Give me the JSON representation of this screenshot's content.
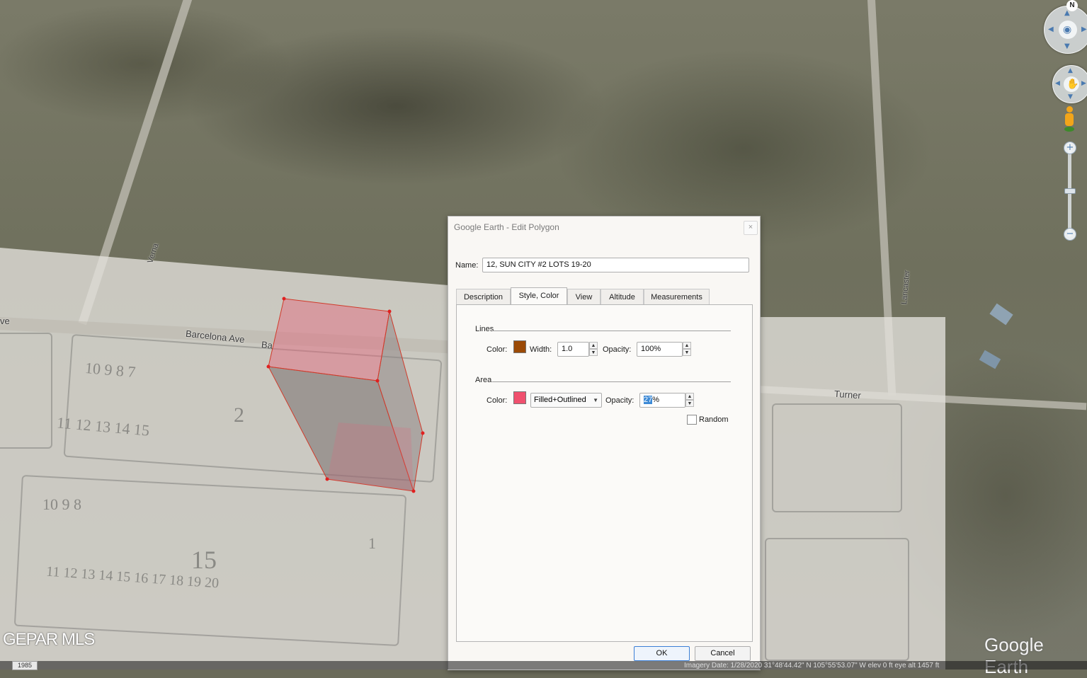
{
  "map": {
    "streets": {
      "barcelona": "Barcelona Ave",
      "barcelona_cut": "Ba",
      "verna": "Verna",
      "turner": "Turner",
      "lancaster": "Lancaster",
      "left_edge": "ve"
    },
    "plat_numbers": [
      "10 9 8 7",
      "2",
      "11 12 13 14 15",
      "15",
      "10 9 8",
      "11 12 13 14 15 16 17 18 19 20",
      "1"
    ],
    "watermark": "GEPAR MLS",
    "logo": "Google Earth",
    "year": "1985",
    "status": "Imagery Date: 1/28/2020    31°48'44.42\" N  105°55'53.07\" W  elev   0 ft    eye alt  1457 ft",
    "polygon_color": "#e5647a",
    "polygon_outline": "#d03a2a"
  },
  "nav": {
    "north": "N",
    "look_icon": "eye-icon",
    "move_icon": "hand-icon",
    "streetview_icon": "pegman-icon",
    "zoom_in": "+",
    "zoom_out": "−"
  },
  "dialog": {
    "title": "Google Earth - Edit Polygon",
    "close": "×",
    "name_label": "Name:",
    "name_value": "12, SUN CITY #2 LOTS 19-20",
    "tabs": [
      {
        "label": "Description"
      },
      {
        "label": "Style, Color"
      },
      {
        "label": "View"
      },
      {
        "label": "Altitude"
      },
      {
        "label": "Measurements"
      }
    ],
    "lines": {
      "group": "Lines",
      "color_label": "Color:",
      "color": "#9b4a06",
      "width_label": "Width:",
      "width_value": "1.0",
      "opacity_label": "Opacity:",
      "opacity_value": "100%"
    },
    "area": {
      "group": "Area",
      "color_label": "Color:",
      "color": "#f0506e",
      "mode": "Filled+Outlined",
      "opacity_label": "Opacity:",
      "opacity_selected": "27",
      "opacity_suffix": "%",
      "random_label": "Random"
    },
    "ok": "OK",
    "cancel": "Cancel"
  }
}
